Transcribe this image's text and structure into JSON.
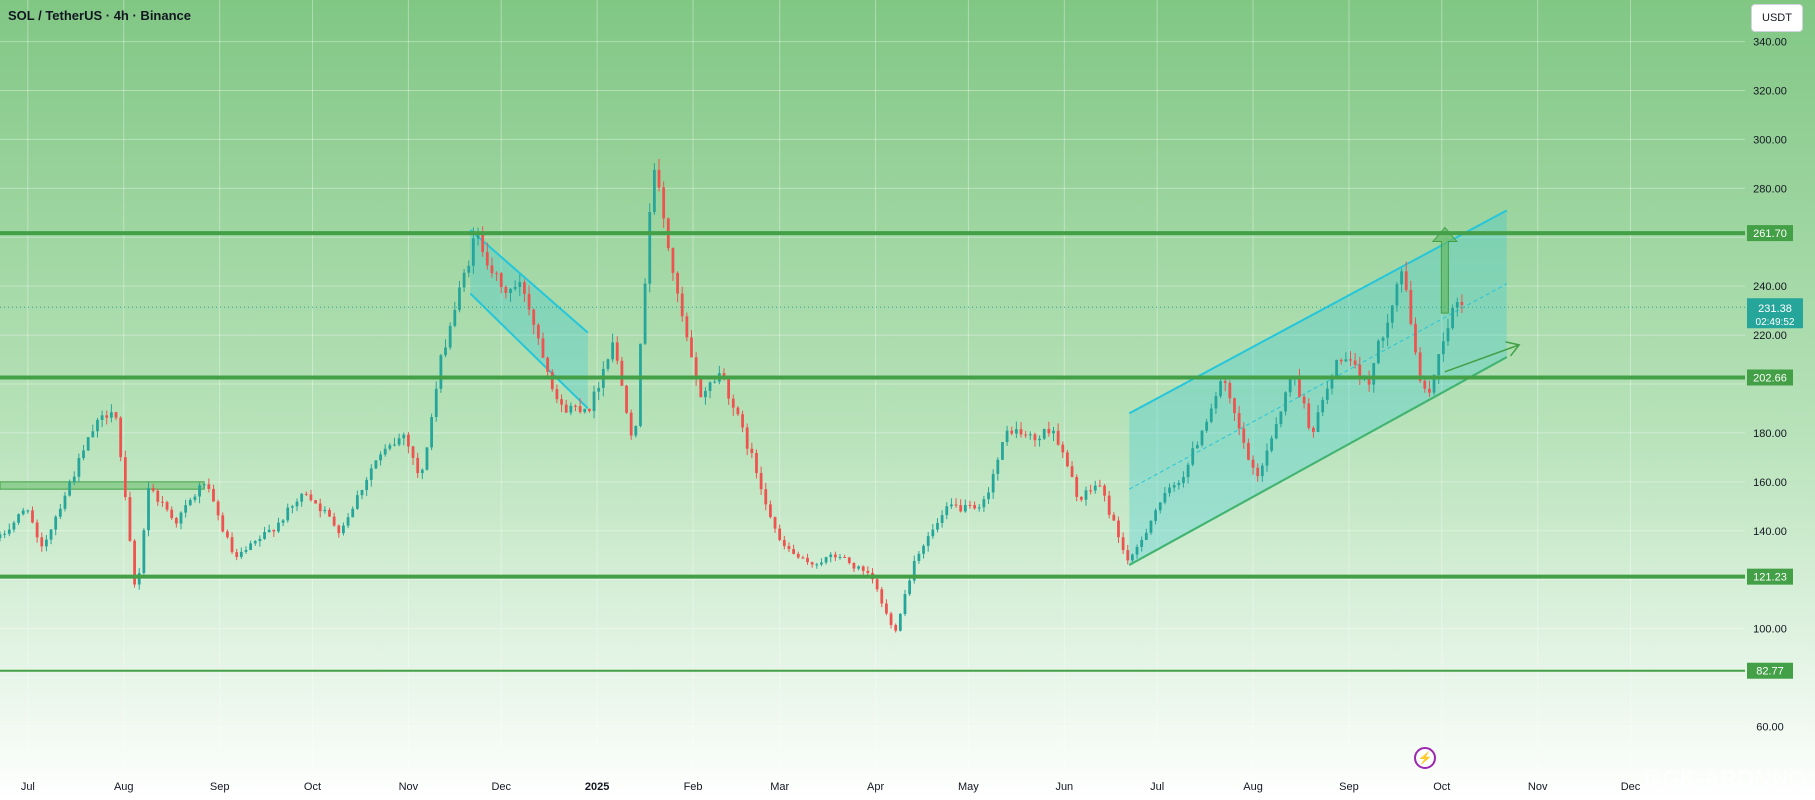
{
  "header": {
    "title": "SOL / TetherUS · 4h · Binance"
  },
  "toolbar": {
    "currency": "USDT"
  },
  "watermark": "@GK-ARONNO",
  "icons": {
    "bolt": "lightning-bolt-icon"
  },
  "colors": {
    "bullish": "#26a69a",
    "bearish": "#ef5350",
    "level_line": "#43a047",
    "channel": "#26c6da",
    "current_price_tag": "#26a69a"
  },
  "chart_data": {
    "type": "candlestick",
    "x_ticks": [
      {
        "label": "Jul",
        "date": "2024-07-01"
      },
      {
        "label": "Aug",
        "date": "2024-08-01"
      },
      {
        "label": "Sep",
        "date": "2024-09-01"
      },
      {
        "label": "Oct",
        "date": "2024-10-01"
      },
      {
        "label": "Nov",
        "date": "2024-11-01"
      },
      {
        "label": "Dec",
        "date": "2024-12-01"
      },
      {
        "label": "2025",
        "date": "2025-01-01",
        "bold": true
      },
      {
        "label": "Feb",
        "date": "2025-02-01"
      },
      {
        "label": "Mar",
        "date": "2025-03-01"
      },
      {
        "label": "Apr",
        "date": "2025-04-01"
      },
      {
        "label": "May",
        "date": "2025-05-01"
      },
      {
        "label": "Jun",
        "date": "2025-06-01"
      },
      {
        "label": "Jul",
        "date": "2025-07-01"
      },
      {
        "label": "Aug",
        "date": "2025-08-01"
      },
      {
        "label": "Sep",
        "date": "2025-09-01"
      },
      {
        "label": "Oct",
        "date": "2025-10-01"
      },
      {
        "label": "Nov",
        "date": "2025-11-01"
      },
      {
        "label": "Dec",
        "date": "2025-12-01"
      }
    ],
    "x_range": [
      "2024-06-22",
      "2026-01-07"
    ],
    "y_ticks": [
      60,
      80,
      100,
      120,
      140,
      160,
      180,
      200,
      220,
      240,
      260,
      280,
      300,
      320,
      340
    ],
    "y_tick_labels": [
      "60.00",
      "80.00",
      "100.00",
      "120.00",
      "140.00",
      "160.00",
      "180.00",
      "200.00",
      "220.00",
      "240.00",
      "260.00",
      "280.00",
      "300.00",
      "320.00",
      "340.00"
    ],
    "ylim": [
      43,
      357
    ],
    "levels": [
      {
        "value": 261.7,
        "label": "261.70"
      },
      {
        "value": 202.66,
        "label": "202.66"
      },
      {
        "value": 121.23,
        "label": "121.23"
      },
      {
        "value": 82.77,
        "label": "82.77"
      }
    ],
    "current_price": {
      "value": 231.38,
      "label": "231.38",
      "countdown": "02:49:52"
    },
    "support_zone": {
      "x0": "2024-06-22",
      "x1": "2024-08-27",
      "y0": 157,
      "y1": 160
    },
    "falling_channel": {
      "upper": [
        [
          "2024-11-21",
          263
        ],
        [
          "2024-12-29",
          221
        ]
      ],
      "lower": [
        [
          "2024-11-21",
          237
        ],
        [
          "2024-12-29",
          190
        ]
      ]
    },
    "rising_channel": {
      "upper": [
        [
          "2025-06-22",
          188
        ],
        [
          "2025-10-22",
          271
        ]
      ],
      "lower": [
        [
          "2025-06-22",
          126
        ],
        [
          "2025-10-22",
          211
        ]
      ],
      "mid": [
        [
          "2025-06-22",
          157
        ],
        [
          "2025-10-22",
          241
        ]
      ]
    },
    "arrows": [
      {
        "from": [
          "2025-10-02",
          229
        ],
        "to": [
          "2025-10-02",
          264
        ],
        "style": "thick-up"
      },
      {
        "from": [
          "2025-10-02",
          205
        ],
        "to": [
          "2025-10-26",
          216
        ],
        "style": "thin"
      }
    ],
    "price_path": [
      [
        "2024-06-22",
        137
      ],
      [
        "2024-07-01",
        150
      ],
      [
        "2024-07-05",
        131
      ],
      [
        "2024-07-13",
        155
      ],
      [
        "2024-07-22",
        181
      ],
      [
        "2024-07-29",
        192
      ],
      [
        "2024-08-05",
        112
      ],
      [
        "2024-08-09",
        158
      ],
      [
        "2024-08-18",
        144
      ],
      [
        "2024-08-27",
        160
      ],
      [
        "2024-09-06",
        128
      ],
      [
        "2024-09-19",
        142
      ],
      [
        "2024-09-29",
        156
      ],
      [
        "2024-10-10",
        140
      ],
      [
        "2024-10-21",
        168
      ],
      [
        "2024-10-31",
        180
      ],
      [
        "2024-11-05",
        160
      ],
      [
        "2024-11-12",
        213
      ],
      [
        "2024-11-23",
        262
      ],
      [
        "2024-12-01",
        238
      ],
      [
        "2024-12-08",
        240
      ],
      [
        "2024-12-20",
        190
      ],
      [
        "2024-12-30",
        191
      ],
      [
        "2025-01-06",
        218
      ],
      [
        "2025-01-13",
        175
      ],
      [
        "2025-01-19",
        292
      ],
      [
        "2025-01-27",
        235
      ],
      [
        "2025-02-03",
        195
      ],
      [
        "2025-02-10",
        205
      ],
      [
        "2025-02-20",
        170
      ],
      [
        "2025-03-01",
        135
      ],
      [
        "2025-03-10",
        126
      ],
      [
        "2025-03-20",
        130
      ],
      [
        "2025-03-31",
        120
      ],
      [
        "2025-04-07",
        98
      ],
      [
        "2025-04-14",
        130
      ],
      [
        "2025-04-25",
        150
      ],
      [
        "2025-05-05",
        148
      ],
      [
        "2025-05-14",
        182
      ],
      [
        "2025-05-23",
        177
      ],
      [
        "2025-05-28",
        183
      ],
      [
        "2025-06-06",
        152
      ],
      [
        "2025-06-12",
        160
      ],
      [
        "2025-06-22",
        126
      ],
      [
        "2025-07-01",
        150
      ],
      [
        "2025-07-10",
        164
      ],
      [
        "2025-07-22",
        202
      ],
      [
        "2025-08-02",
        160
      ],
      [
        "2025-08-14",
        205
      ],
      [
        "2025-08-20",
        180
      ],
      [
        "2025-08-29",
        212
      ],
      [
        "2025-09-07",
        200
      ],
      [
        "2025-09-18",
        247
      ],
      [
        "2025-09-25",
        195
      ],
      [
        "2025-09-28",
        200
      ],
      [
        "2025-10-01",
        218
      ],
      [
        "2025-10-06",
        234
      ],
      [
        "2025-10-08",
        231
      ]
    ]
  }
}
